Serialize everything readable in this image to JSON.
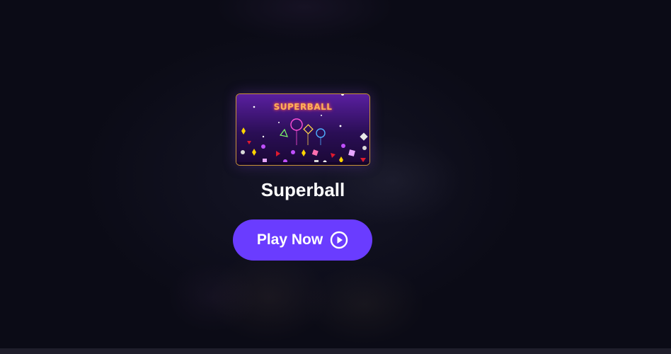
{
  "game": {
    "title": "Superball",
    "thumbnail_logo": "SUPERBALL"
  },
  "cta": {
    "label": "Play Now",
    "icon": "play-circle-icon"
  },
  "colors": {
    "background": "#0b0b16",
    "button": "#6a3cff",
    "thumbnail_border": "#c89336",
    "bottom_bar": "#1f1e2b"
  }
}
